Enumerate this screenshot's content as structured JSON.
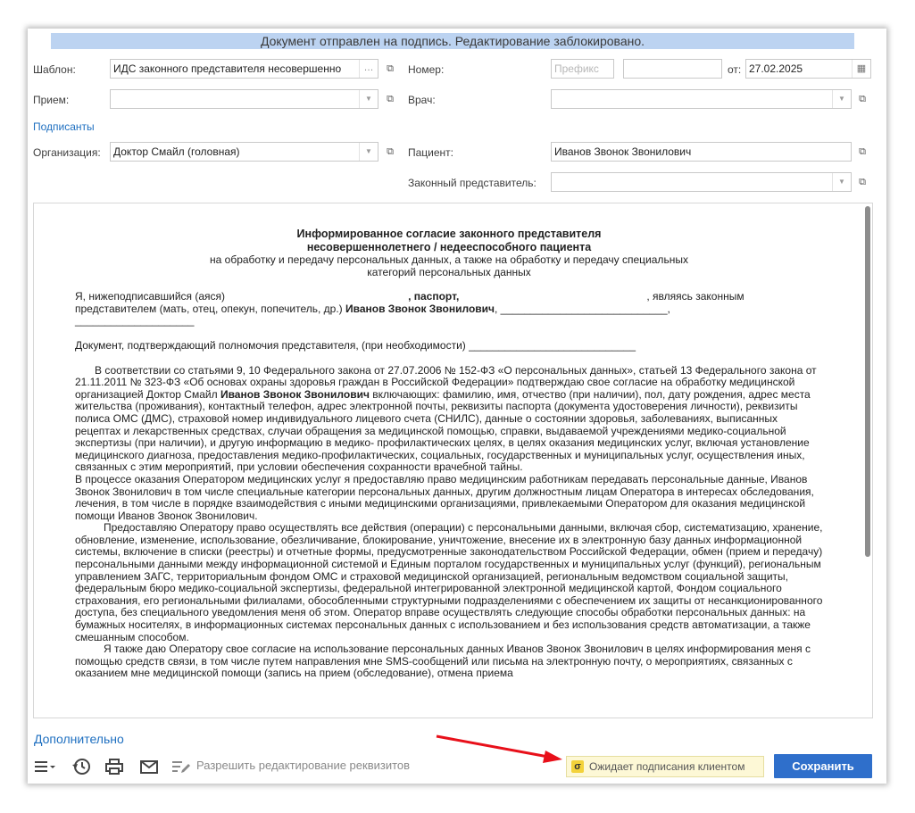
{
  "banner": "Документ отправлен на подпись. Редактирование заблокировано.",
  "form": {
    "template_label": "Шаблон:",
    "template_value": "ИДС законного представителя несовершенно",
    "number_label": "Номер:",
    "prefix_placeholder": "Префикс",
    "number_value": "",
    "from_label": "от:",
    "date_value": "27.02.2025",
    "appointment_label": "Прием:",
    "appointment_value": "",
    "doctor_label": "Врач:",
    "doctor_value": "",
    "signers_link": "Подписанты",
    "org_label": "Организация:",
    "org_value": "Доктор Смайл (головная)",
    "patient_label": "Пациент:",
    "patient_value": "Иванов Звонок Звонилович",
    "rep_label": "Законный представитель:",
    "rep_value": ""
  },
  "document": {
    "title1": "Информированное согласие законного представителя",
    "title2": "несовершеннолетнего / недееспособного пациента",
    "subtitle1": "на обработку и передачу персональных данных, а также на обработку и передачу специальных",
    "subtitle2": "категорий персональных данных",
    "p1_a": "Я, нижеподписавшийся (аяся)",
    "p1_b": ", паспорт,",
    "p1_c": ", являясь законным",
    "p1_d": "представителем (мать, отец, опекун, попечитель, др.)",
    "patient_name": "Иванов Звонок Звонилович",
    "p2": "Документ, подтверждающий полномочия представителя, (при необходимости) ____________________________",
    "p3_a": "В соответствии со статьями 9, 10 Федерального закона от 27.07.2006 № 152-ФЗ «О персональных данных», статьей 13 Федерального закона от 21.11.2011 № 323-ФЗ «Об основах охраны здоровья граждан в Российской Федерации» подтверждаю свое согласие на обработку медицинской организацией Доктор Смайл",
    "p3_b": "включающих: фамилию, имя, отчество (при наличии), пол, дату рождения, адрес места жительства (проживания), контактный телефон, адрес электронной почты, реквизиты паспорта (документа удостоверения личности), реквизиты полиса ОМС (ДМС), страховой номер индивидуального лицевого счета (СНИЛС), данные о состоянии здоровья, заболеваниях, выписанных рецептах и лекарственных средствах, случаи обращения за медицинской помощью, справки, выдаваемой учреждениями медико-социальной экспертизы (при наличии), и другую информацию в медико- профилактических целях, в целях оказания медицинских услуг, включая установление медицинского диагноза, предоставления медико-профилактических, социальных, государственных и муниципальных услуг, осуществления иных, связанных с этим мероприятий, при условии обеспечения сохранности врачебной тайны.",
    "p4": "В процессе оказания Оператором медицинских услуг я предоставляю право медицинским работникам передавать персональные данные, Иванов Звонок Звонилович в том числе специальные категории персональных данных, другим должностным лицам Оператора в интересах обследования, лечения, в том числе в порядке взаимодействия с иными медицинскими организациями, привлекаемыми Оператором для оказания медицинской помощи Иванов Звонок Звонилович.",
    "p5": "Предоставляю Оператору право осуществлять все действия (операции) с персональными данными, включая сбор, систематизацию, хранение, обновление, изменение, использование, обезличивание, блокирование, уничтожение, внесение их в электронную базу данных информационной системы, включение в списки (реестры) и отчетные формы, предусмотренные законодательством Российской Федерации, обмен (прием и передачу) персональными данными между информационной системой и Единым порталом государственных и муниципальных услуг (функций), региональным управлением ЗАГС, территориальным фондом ОМС и страховой медицинской организацией, региональным ведомством социальной защиты, федеральным бюро медико-социальной экспертизы, федеральной интегрированной электронной медицинской картой, Фондом социального страхования, его региональными филиалами, обособленными структурными подразделениями с обеспечением их защиты от несанкционированного доступа, без специального уведомления меня об этом. Оператор вправе осуществлять следующие способы обработки персональных данных: на бумажных носителях, в информационных системах персональных данных с использованием и без использования средств автоматизации, а также смешанным способом.",
    "p6": "Я также даю Оператору свое согласие на использование персональных данных Иванов Звонок Звонилович в целях информирования меня с помощью средств связи, в том числе путем направления мне SMS-сообщений или письма на электронную почту, о мероприятиях, связанных с оказанием мне медицинской помощи (запись на прием (обследование), отмена приема"
  },
  "footer": {
    "more_link": "Дополнительно",
    "allow_edit": "Разрешить редактирование реквизитов",
    "status_text": "Ожидает подписания клиентом",
    "save_label": "Сохранить"
  }
}
